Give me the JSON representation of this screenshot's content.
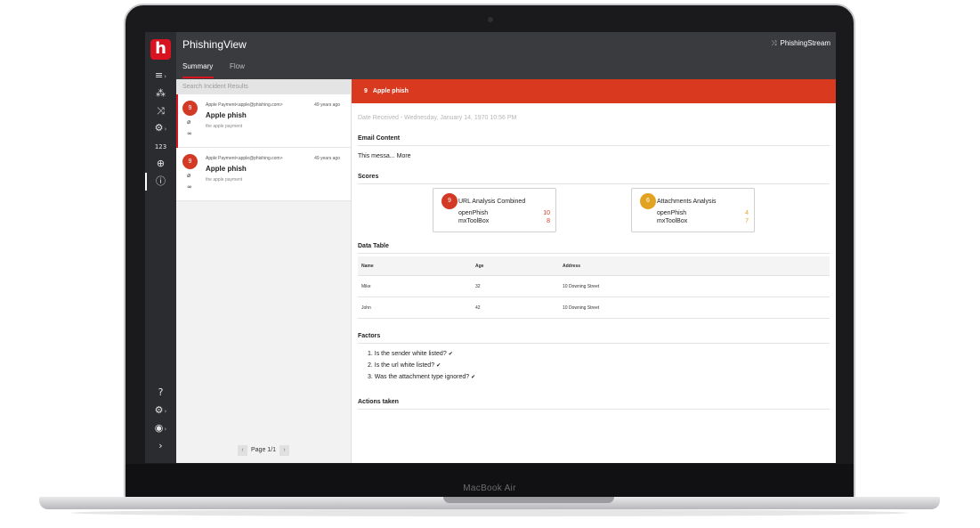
{
  "device": {
    "bezel_label": "MacBook Air"
  },
  "rail": {
    "logo": "h",
    "items": [
      {
        "icon": "database-icon",
        "glyph": "≡",
        "caret": "›"
      },
      {
        "icon": "hierarchy-icon",
        "glyph": "⁂"
      },
      {
        "icon": "shuffle-icon",
        "glyph": "⤨"
      },
      {
        "icon": "gear-icon",
        "glyph": "⚙",
        "caret": "›"
      },
      {
        "icon": "numbers-icon",
        "text": "123"
      },
      {
        "icon": "crosshair-icon",
        "glyph": "⊕"
      },
      {
        "icon": "alert-icon",
        "glyph": "ⓘ"
      }
    ],
    "bottom_items": [
      {
        "icon": "help-icon",
        "glyph": "?"
      },
      {
        "icon": "settings-icon",
        "glyph": "⚙",
        "caret": "›"
      },
      {
        "icon": "user-icon",
        "glyph": "◉",
        "caret": "›"
      },
      {
        "icon": "expand-icon",
        "glyph": "›"
      }
    ]
  },
  "header": {
    "title": "PhishingView",
    "stream": "PhishingStream",
    "tabs": [
      {
        "label": "Summary",
        "active": true
      },
      {
        "label": "Flow",
        "active": false
      }
    ]
  },
  "search": {
    "placeholder": "Search Incident Results"
  },
  "incidents": [
    {
      "severity": "9",
      "from": "Apple Payment<apple@phishing.com>",
      "age": "49 years ago",
      "subject": "Apple phish",
      "preview": "the apple payment"
    },
    {
      "severity": "9",
      "from": "Apple Payment<apple@phishing.com>",
      "age": "49 years ago",
      "subject": "Apple phish",
      "preview": "the apple payment"
    }
  ],
  "pager": {
    "prev": "‹",
    "label": "Page 1/1",
    "next": "›"
  },
  "detail": {
    "header": {
      "severity": "9",
      "title": "Apple phish"
    },
    "date_received": "Date Received - Wednesday, January 14, 1970 10:56 PM",
    "email_content_title": "Email Content",
    "email_body": "This messa...",
    "email_more": "More",
    "scores_title": "Scores",
    "scores": [
      {
        "score": "9",
        "title": "URL Analysis Combined",
        "color": "#d23a26",
        "rows": [
          {
            "label": "openPhish",
            "value": "10"
          },
          {
            "label": "mxToolBox",
            "value": "8"
          }
        ]
      },
      {
        "score": "6",
        "title": "Attachments Analysis",
        "color": "#e3a322",
        "rows": [
          {
            "label": "openPhish",
            "value": "4"
          },
          {
            "label": "mxToolBox",
            "value": "7"
          }
        ]
      }
    ],
    "data_table_title": "Data Table",
    "table": {
      "columns": [
        "Name",
        "Age",
        "Address"
      ],
      "rows": [
        [
          "Mike",
          "32",
          "10 Downing Street"
        ],
        [
          "John",
          "42",
          "10 Downing Street"
        ]
      ]
    },
    "factors_title": "Factors",
    "factors": [
      "1. Is the sender white listed?",
      "2. Is the url white listed?",
      "3. Was the attachment type ignored?"
    ],
    "factor_check": "✔",
    "actions_title": "Actions taken"
  }
}
